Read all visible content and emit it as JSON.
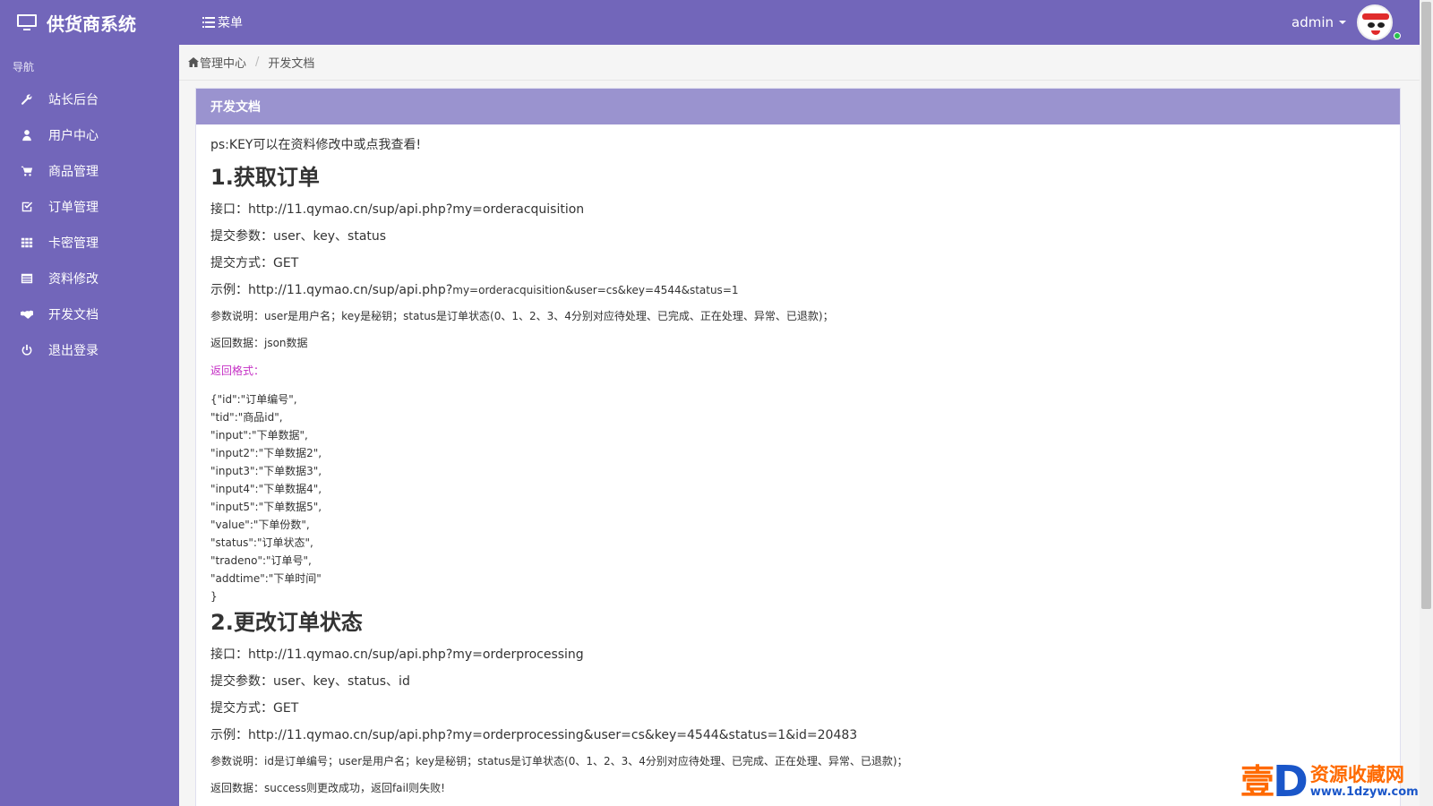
{
  "sidebar": {
    "brand": "供货商系统",
    "nav_header": "导航",
    "items": [
      {
        "label": "站长后台",
        "icon": "wrench-icon"
      },
      {
        "label": "用户中心",
        "icon": "user-icon"
      },
      {
        "label": "商品管理",
        "icon": "cart-icon"
      },
      {
        "label": "订单管理",
        "icon": "check-square-icon"
      },
      {
        "label": "卡密管理",
        "icon": "grid-icon"
      },
      {
        "label": "资料修改",
        "icon": "list-icon"
      },
      {
        "label": "开发文档",
        "icon": "handshake-icon"
      },
      {
        "label": "退出登录",
        "icon": "power-icon"
      }
    ]
  },
  "header": {
    "menu_label": "菜单",
    "user_name": "admin"
  },
  "breadcrumb": {
    "home": "管理中心",
    "current": "开发文档"
  },
  "panel": {
    "title": "开发文档",
    "ps": "ps:KEY可以在资料修改中或点我查看!",
    "section1": {
      "heading": "1.获取订单",
      "api": "接口：http://11.qymao.cn/sup/api.php?my=orderacquisition",
      "params": "提交参数：user、key、status",
      "method": "提交方式：GET",
      "example_prefix": "示例：http://11.qymao.cn/sup/api.php?",
      "example_suffix": "my=orderacquisition&user=cs&key=4544&status=1",
      "param_desc": "参数说明：user是用户名；key是秘钥；status是订单状态(0、1、2、3、4分别对应待处理、已完成、正在处理、异常、已退款)；",
      "return_data": "返回数据：json数据",
      "return_format": "返回格式：",
      "json_lines": [
        "{\"id\":\"订单编号\",",
        "\"tid\":\"商品id\",",
        "\"input\":\"下单数据\",",
        "\"input2\":\"下单数据2\",",
        "\"input3\":\"下单数据3\",",
        "\"input4\":\"下单数据4\",",
        "\"input5\":\"下单数据5\",",
        "\"value\":\"下单份数\",",
        "\"status\":\"订单状态\",",
        "\"tradeno\":\"订单号\",",
        "\"addtime\":\"下单时间\"",
        "}"
      ]
    },
    "section2": {
      "heading": "2.更改订单状态",
      "api": "接口：http://11.qymao.cn/sup/api.php?my=orderprocessing",
      "params": "提交参数：user、key、status、id",
      "method": "提交方式：GET",
      "example": "示例：http://11.qymao.cn/sup/api.php?my=orderprocessing&user=cs&key=4544&status=1&id=20483",
      "param_desc": "参数说明：id是订单编号；user是用户名；key是秘钥；status是订单状态(0、1、2、3、4分别对应待处理、已完成、正在处理、异常、已退款)；",
      "return_data": "返回数据：success则更改成功，返回fail则失败!"
    }
  },
  "watermark": {
    "mark": "壹",
    "letter": "D",
    "title": "资源收藏网",
    "url": "www.1dzyw.com"
  },
  "colors": {
    "sidebar_bg": "#7266ba",
    "panel_heading_bg": "#9a93cf",
    "accent_pink": "#c530c5"
  }
}
